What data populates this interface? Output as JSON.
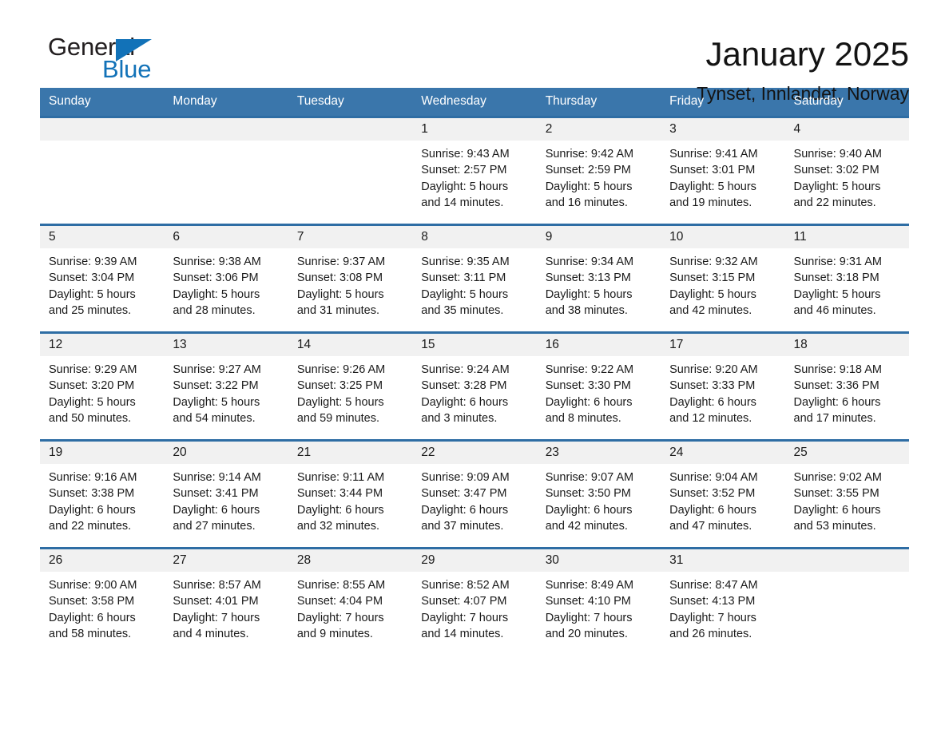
{
  "brand": {
    "name_part1": "General",
    "name_part2": "Blue",
    "logo_icon": "triangle-logo-icon",
    "accent_color": "#1272b8"
  },
  "header": {
    "title": "January 2025",
    "location": "Tynset, Innlandet, Norway"
  },
  "theme": {
    "header_bg": "#3a76ab",
    "row_divider": "#2e6da4",
    "day_band_bg": "#f1f1f1",
    "text": "#1a1a1a"
  },
  "weekday_headers": [
    "Sunday",
    "Monday",
    "Tuesday",
    "Wednesday",
    "Thursday",
    "Friday",
    "Saturday"
  ],
  "weeks": [
    [
      {
        "day": "",
        "sunrise": "",
        "sunset": "",
        "daylight": "",
        "empty": true
      },
      {
        "day": "",
        "sunrise": "",
        "sunset": "",
        "daylight": "",
        "empty": true
      },
      {
        "day": "",
        "sunrise": "",
        "sunset": "",
        "daylight": "",
        "empty": true
      },
      {
        "day": "1",
        "sunrise": "Sunrise: 9:43 AM",
        "sunset": "Sunset: 2:57 PM",
        "daylight": "Daylight: 5 hours and 14 minutes."
      },
      {
        "day": "2",
        "sunrise": "Sunrise: 9:42 AM",
        "sunset": "Sunset: 2:59 PM",
        "daylight": "Daylight: 5 hours and 16 minutes."
      },
      {
        "day": "3",
        "sunrise": "Sunrise: 9:41 AM",
        "sunset": "Sunset: 3:01 PM",
        "daylight": "Daylight: 5 hours and 19 minutes."
      },
      {
        "day": "4",
        "sunrise": "Sunrise: 9:40 AM",
        "sunset": "Sunset: 3:02 PM",
        "daylight": "Daylight: 5 hours and 22 minutes."
      }
    ],
    [
      {
        "day": "5",
        "sunrise": "Sunrise: 9:39 AM",
        "sunset": "Sunset: 3:04 PM",
        "daylight": "Daylight: 5 hours and 25 minutes."
      },
      {
        "day": "6",
        "sunrise": "Sunrise: 9:38 AM",
        "sunset": "Sunset: 3:06 PM",
        "daylight": "Daylight: 5 hours and 28 minutes."
      },
      {
        "day": "7",
        "sunrise": "Sunrise: 9:37 AM",
        "sunset": "Sunset: 3:08 PM",
        "daylight": "Daylight: 5 hours and 31 minutes."
      },
      {
        "day": "8",
        "sunrise": "Sunrise: 9:35 AM",
        "sunset": "Sunset: 3:11 PM",
        "daylight": "Daylight: 5 hours and 35 minutes."
      },
      {
        "day": "9",
        "sunrise": "Sunrise: 9:34 AM",
        "sunset": "Sunset: 3:13 PM",
        "daylight": "Daylight: 5 hours and 38 minutes."
      },
      {
        "day": "10",
        "sunrise": "Sunrise: 9:32 AM",
        "sunset": "Sunset: 3:15 PM",
        "daylight": "Daylight: 5 hours and 42 minutes."
      },
      {
        "day": "11",
        "sunrise": "Sunrise: 9:31 AM",
        "sunset": "Sunset: 3:18 PM",
        "daylight": "Daylight: 5 hours and 46 minutes."
      }
    ],
    [
      {
        "day": "12",
        "sunrise": "Sunrise: 9:29 AM",
        "sunset": "Sunset: 3:20 PM",
        "daylight": "Daylight: 5 hours and 50 minutes."
      },
      {
        "day": "13",
        "sunrise": "Sunrise: 9:27 AM",
        "sunset": "Sunset: 3:22 PM",
        "daylight": "Daylight: 5 hours and 54 minutes."
      },
      {
        "day": "14",
        "sunrise": "Sunrise: 9:26 AM",
        "sunset": "Sunset: 3:25 PM",
        "daylight": "Daylight: 5 hours and 59 minutes."
      },
      {
        "day": "15",
        "sunrise": "Sunrise: 9:24 AM",
        "sunset": "Sunset: 3:28 PM",
        "daylight": "Daylight: 6 hours and 3 minutes."
      },
      {
        "day": "16",
        "sunrise": "Sunrise: 9:22 AM",
        "sunset": "Sunset: 3:30 PM",
        "daylight": "Daylight: 6 hours and 8 minutes."
      },
      {
        "day": "17",
        "sunrise": "Sunrise: 9:20 AM",
        "sunset": "Sunset: 3:33 PM",
        "daylight": "Daylight: 6 hours and 12 minutes."
      },
      {
        "day": "18",
        "sunrise": "Sunrise: 9:18 AM",
        "sunset": "Sunset: 3:36 PM",
        "daylight": "Daylight: 6 hours and 17 minutes."
      }
    ],
    [
      {
        "day": "19",
        "sunrise": "Sunrise: 9:16 AM",
        "sunset": "Sunset: 3:38 PM",
        "daylight": "Daylight: 6 hours and 22 minutes."
      },
      {
        "day": "20",
        "sunrise": "Sunrise: 9:14 AM",
        "sunset": "Sunset: 3:41 PM",
        "daylight": "Daylight: 6 hours and 27 minutes."
      },
      {
        "day": "21",
        "sunrise": "Sunrise: 9:11 AM",
        "sunset": "Sunset: 3:44 PM",
        "daylight": "Daylight: 6 hours and 32 minutes."
      },
      {
        "day": "22",
        "sunrise": "Sunrise: 9:09 AM",
        "sunset": "Sunset: 3:47 PM",
        "daylight": "Daylight: 6 hours and 37 minutes."
      },
      {
        "day": "23",
        "sunrise": "Sunrise: 9:07 AM",
        "sunset": "Sunset: 3:50 PM",
        "daylight": "Daylight: 6 hours and 42 minutes."
      },
      {
        "day": "24",
        "sunrise": "Sunrise: 9:04 AM",
        "sunset": "Sunset: 3:52 PM",
        "daylight": "Daylight: 6 hours and 47 minutes."
      },
      {
        "day": "25",
        "sunrise": "Sunrise: 9:02 AM",
        "sunset": "Sunset: 3:55 PM",
        "daylight": "Daylight: 6 hours and 53 minutes."
      }
    ],
    [
      {
        "day": "26",
        "sunrise": "Sunrise: 9:00 AM",
        "sunset": "Sunset: 3:58 PM",
        "daylight": "Daylight: 6 hours and 58 minutes."
      },
      {
        "day": "27",
        "sunrise": "Sunrise: 8:57 AM",
        "sunset": "Sunset: 4:01 PM",
        "daylight": "Daylight: 7 hours and 4 minutes."
      },
      {
        "day": "28",
        "sunrise": "Sunrise: 8:55 AM",
        "sunset": "Sunset: 4:04 PM",
        "daylight": "Daylight: 7 hours and 9 minutes."
      },
      {
        "day": "29",
        "sunrise": "Sunrise: 8:52 AM",
        "sunset": "Sunset: 4:07 PM",
        "daylight": "Daylight: 7 hours and 14 minutes."
      },
      {
        "day": "30",
        "sunrise": "Sunrise: 8:49 AM",
        "sunset": "Sunset: 4:10 PM",
        "daylight": "Daylight: 7 hours and 20 minutes."
      },
      {
        "day": "31",
        "sunrise": "Sunrise: 8:47 AM",
        "sunset": "Sunset: 4:13 PM",
        "daylight": "Daylight: 7 hours and 26 minutes."
      },
      {
        "day": "",
        "sunrise": "",
        "sunset": "",
        "daylight": "",
        "empty": true
      }
    ]
  ]
}
